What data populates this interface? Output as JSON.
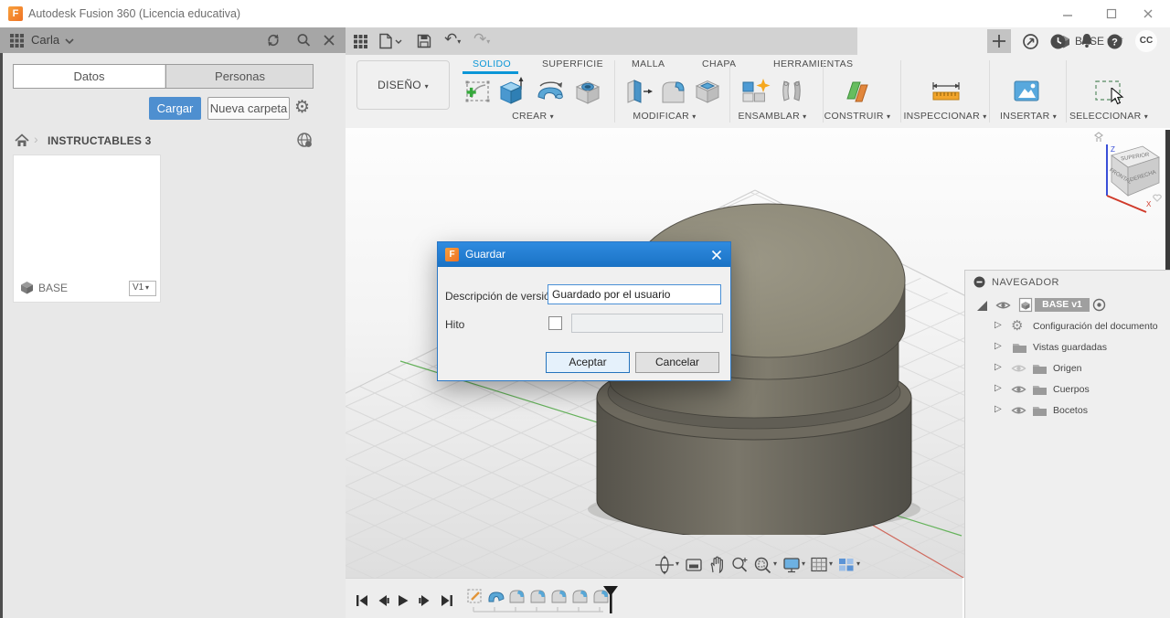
{
  "window": {
    "title": "Autodesk Fusion 360 (Licencia educativa)"
  },
  "icons": {
    "fusion_logo": "F"
  },
  "data_panel": {
    "user": "Carla",
    "tabs": [
      {
        "label": "Datos"
      },
      {
        "label": "Personas"
      }
    ],
    "upload_button": "Cargar",
    "new_folder_button": "Nueva carpeta",
    "breadcrumb": "INSTRUCTABLES 3",
    "project": {
      "name": "BASE",
      "version": "V1"
    }
  },
  "tab_strip": {
    "document_tab": "BASE v1*",
    "avatar": "CC"
  },
  "ribbon": {
    "workspace": "DISEÑO",
    "tabs": [
      {
        "label": "SOLIDO",
        "active": true
      },
      {
        "label": "SUPERFICIE"
      },
      {
        "label": "MALLA"
      },
      {
        "label": "CHAPA"
      },
      {
        "label": "HERRAMIENTAS"
      }
    ],
    "groups": [
      {
        "label": "CREAR"
      },
      {
        "label": "MODIFICAR"
      },
      {
        "label": "ENSAMBLAR"
      },
      {
        "label": "CONSTRUIR"
      },
      {
        "label": "INSPECCIONAR"
      },
      {
        "label": "INSERTAR"
      },
      {
        "label": "SELECCIONAR"
      }
    ]
  },
  "dialog": {
    "title": "Guardar",
    "version_label": "Descripción de versión",
    "version_value": "Guardado por el usuario",
    "milestone_label": "Hito",
    "ok_button": "Aceptar",
    "cancel_button": "Cancelar"
  },
  "navigator": {
    "title": "NAVEGADOR",
    "root": "BASE v1",
    "items": [
      {
        "label": "Configuración del documento"
      },
      {
        "label": "Vistas guardadas"
      },
      {
        "label": "Origen"
      },
      {
        "label": "Cuerpos"
      },
      {
        "label": "Bocetos"
      }
    ]
  },
  "viewcube": {
    "top": "SUPERIOR",
    "front": "FRONTAL",
    "right": "DERECHA",
    "axis_z": "Z",
    "axis_x": "X"
  },
  "colors": {
    "accent_blue": "#0a96d7",
    "dialog_titlebar": "#1e7ed6",
    "upload_button": "#4e8fd0"
  }
}
